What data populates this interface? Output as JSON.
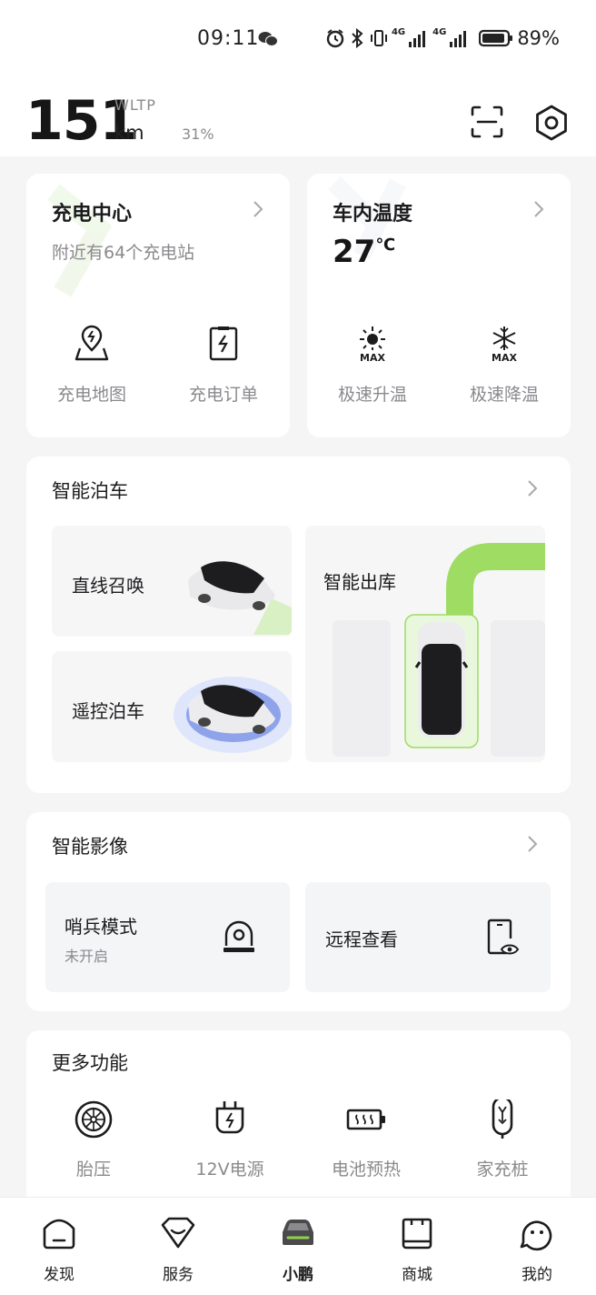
{
  "status_bar": {
    "time": "09:11",
    "net1": "4G",
    "net2": "4G",
    "battery": "89%"
  },
  "header": {
    "range_value": "151",
    "range_unit": "km",
    "range_standard": "WLTP",
    "battery_percent": "31%"
  },
  "charging": {
    "title": "充电中心",
    "subtitle": "附近有64个充电站",
    "actions": [
      {
        "label": "充电地图",
        "icon": "map-pin-icon"
      },
      {
        "label": "充电订单",
        "icon": "charge-order-icon"
      }
    ]
  },
  "temperature": {
    "title": "车内温度",
    "value": "27",
    "unit": "℃",
    "actions": [
      {
        "label": "极速升温",
        "icon": "heat-max-icon",
        "badge": "MAX"
      },
      {
        "label": "极速降温",
        "icon": "cool-max-icon",
        "badge": "MAX"
      }
    ]
  },
  "parking": {
    "title": "智能泊车",
    "tiles": [
      {
        "label": "直线召唤"
      },
      {
        "label": "遥控泊车"
      },
      {
        "label": "智能出库"
      }
    ]
  },
  "imaging": {
    "title": "智能影像",
    "tiles": [
      {
        "label": "哨兵模式",
        "status": "未开启",
        "icon": "sentry-camera-icon"
      },
      {
        "label": "远程查看",
        "icon": "remote-view-icon"
      }
    ]
  },
  "more": {
    "title": "更多功能",
    "items": [
      {
        "label": "胎压",
        "icon": "tire-icon"
      },
      {
        "label": "12V电源",
        "icon": "power-plug-icon"
      },
      {
        "label": "电池预热",
        "icon": "battery-heat-icon"
      },
      {
        "label": "家充桩",
        "icon": "home-charger-icon"
      }
    ]
  },
  "nav": {
    "items": [
      {
        "label": "发现",
        "icon": "discover-icon"
      },
      {
        "label": "服务",
        "icon": "service-icon"
      },
      {
        "label": "小鹏",
        "icon": "car-icon",
        "active": true
      },
      {
        "label": "商城",
        "icon": "mall-icon"
      },
      {
        "label": "我的",
        "icon": "profile-icon"
      }
    ]
  },
  "colors": {
    "accent_green": "#8fd24a",
    "text_primary": "#1c1c1e",
    "text_secondary": "#8a8a8e",
    "background": "#f5f5f6",
    "card": "#ffffff"
  }
}
